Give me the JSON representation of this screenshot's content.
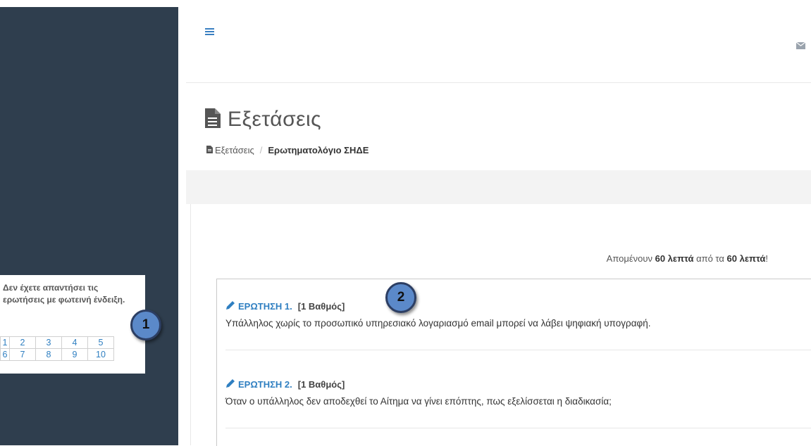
{
  "topbar": {
    "menu_icon": "hamburger-icon",
    "mail_icon": "envelope-icon"
  },
  "header": {
    "title": "Εξετάσεις",
    "title_icon": "document-icon",
    "breadcrumb": {
      "root": "Εξετάσεις",
      "separator": "/",
      "current": "Ερωτηματολόγιο ΣΗΔΕ"
    }
  },
  "timer": {
    "prefix": "Απομένουν",
    "remaining": "60 λεπτά",
    "middle": "από τα",
    "total": "60 λεπτά",
    "suffix": "!"
  },
  "questions": [
    {
      "label": "ΕΡΩΤΗΣΗ 1.",
      "points": "[1 Βαθμός]",
      "text": "Υπάλληλος χωρίς το προσωπικό υπηρεσιακό λογαριασμό email μπορεί να λάβει ψηφιακή υπογραφή."
    },
    {
      "label": "ΕΡΩΤΗΣΗ 2.",
      "points": "[1 Βαθμός]",
      "text": "Όταν ο υπάλληλος δεν αποδεχθεί το Αίτημα να γίνει επόπτης, πως εξελίσσεται η διαδικασία;"
    }
  ],
  "navigator": {
    "message": "Δεν έχετε απαντήσει τις ερωτήσεις με φωτεινή ένδειξη.",
    "rows": [
      [
        "1",
        "2",
        "3",
        "4",
        "5"
      ],
      [
        "6",
        "7",
        "8",
        "9",
        "10"
      ]
    ]
  },
  "callouts": [
    "1",
    "2"
  ],
  "colors": {
    "sidebar": "#2f3e4e",
    "accent": "#2f7fc1",
    "callout_fill": "#5b89c9"
  }
}
